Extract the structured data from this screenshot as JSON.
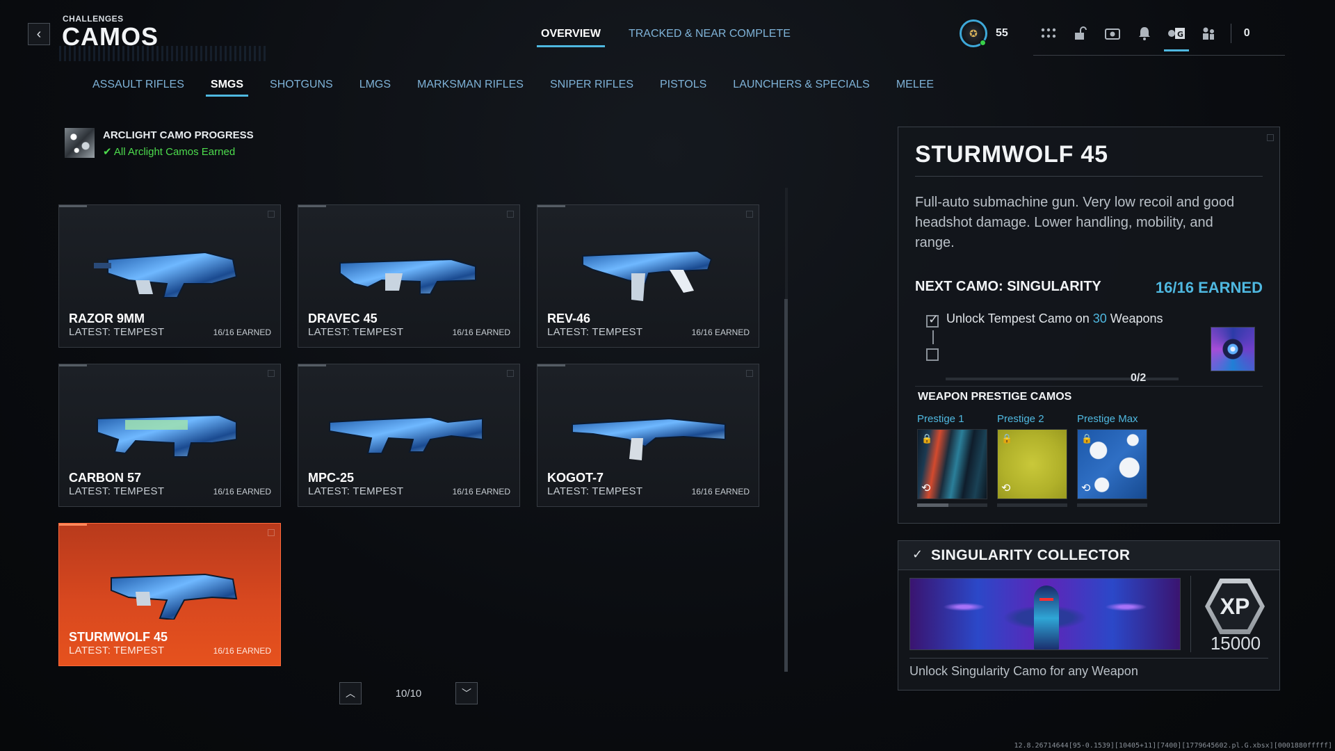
{
  "header": {
    "back_icon": "chevron-left-icon",
    "breadcrumb": "CHALLENGES",
    "title": "CAMOS"
  },
  "top_tabs": [
    {
      "label": "OVERVIEW",
      "active": true
    },
    {
      "label": "TRACKED & NEAR COMPLETE",
      "active": false
    }
  ],
  "topbar": {
    "level": "55",
    "notifications_count": "0",
    "icons": [
      "grid-menu-icon",
      "unlock-icon",
      "camera-icon",
      "bell-icon",
      "settings-gamepad-icon",
      "friends-icon"
    ]
  },
  "category_tabs": [
    {
      "label": "ASSAULT RIFLES",
      "active": false
    },
    {
      "label": "SMGS",
      "active": true
    },
    {
      "label": "SHOTGUNS",
      "active": false
    },
    {
      "label": "LMGS",
      "active": false
    },
    {
      "label": "MARKSMAN RIFLES",
      "active": false
    },
    {
      "label": "SNIPER RIFLES",
      "active": false
    },
    {
      "label": "PISTOLS",
      "active": false
    },
    {
      "label": "LAUNCHERS & SPECIALS",
      "active": false
    },
    {
      "label": "MELEE",
      "active": false
    }
  ],
  "arclight": {
    "title": "ARCLIGHT CAMO PROGRESS",
    "status": "All Arclight Camos Earned"
  },
  "weapons": [
    {
      "name": "RAZOR 9MM",
      "latest": "LATEST: TEMPEST",
      "earned": "16/16 EARNED",
      "selected": false
    },
    {
      "name": "DRAVEC 45",
      "latest": "LATEST: TEMPEST",
      "earned": "16/16 EARNED",
      "selected": false
    },
    {
      "name": "REV-46",
      "latest": "LATEST: TEMPEST",
      "earned": "16/16 EARNED",
      "selected": false
    },
    {
      "name": "CARBON 57",
      "latest": "LATEST: TEMPEST",
      "earned": "16/16 EARNED",
      "selected": false
    },
    {
      "name": "MPC-25",
      "latest": "LATEST: TEMPEST",
      "earned": "16/16 EARNED",
      "selected": false
    },
    {
      "name": "KOGOT-7",
      "latest": "LATEST: TEMPEST",
      "earned": "16/16 EARNED",
      "selected": false
    },
    {
      "name": "STURMWOLF 45",
      "latest": "LATEST: TEMPEST",
      "earned": "16/16 EARNED",
      "selected": true
    }
  ],
  "pager": {
    "text": "10/10"
  },
  "details": {
    "title": "STURMWOLF 45",
    "description": "Full-auto submachine gun. Very low recoil and good headshot damage. Lower handling, mobility, and range.",
    "next_camo_label": "NEXT CAMO: SINGULARITY",
    "next_camo_earned": "16/16 EARNED",
    "requirement_prefix": "Unlock Tempest Camo on ",
    "requirement_count": "30",
    "requirement_suffix": " Weapons",
    "progress": "0/2",
    "progress_fraction": 0.0,
    "prestige_heading": "WEAPON PRESTIGE CAMOS",
    "prestige": [
      {
        "label": "Prestige 1",
        "fill": 0.45
      },
      {
        "label": "Prestige 2",
        "fill": 0.0
      },
      {
        "label": "Prestige Max",
        "fill": 0.0
      }
    ]
  },
  "collector": {
    "title": "SINGULARITY COLLECTOR",
    "xp_label": "XP",
    "xp_value": "15000",
    "description": "Unlock Singularity Camo for any Weapon"
  },
  "footer_meta": "12.8.26714644[95-0.1539][10405+11][7400][1779645602.pl.G.xbsx][0001880fffff]",
  "colors": {
    "accent": "#4fb8e0",
    "selected_card": "#d8481f",
    "success": "#4ddc4d"
  }
}
